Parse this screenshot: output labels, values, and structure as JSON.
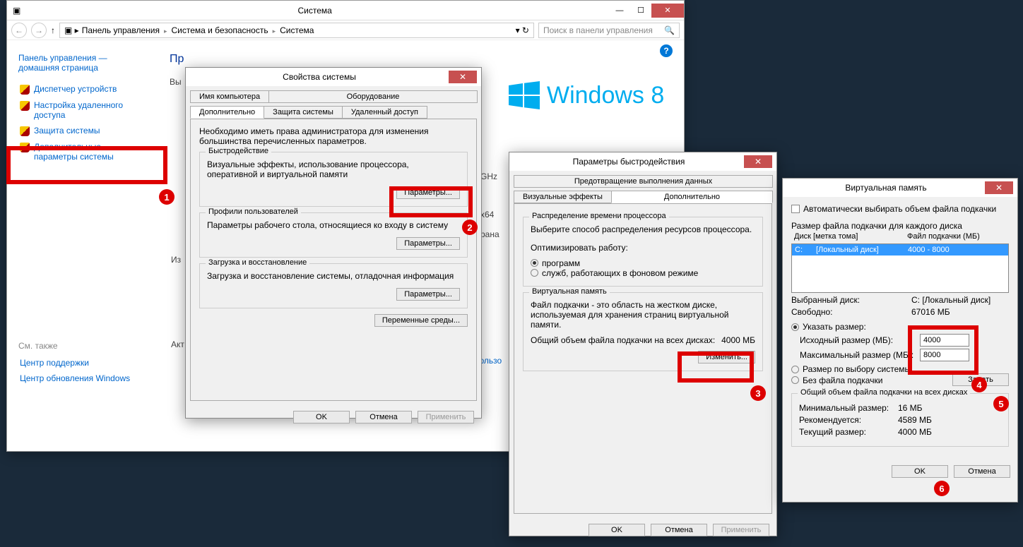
{
  "system_window": {
    "title": "Система",
    "breadcrumb": {
      "root": "Панель управления",
      "b1": "Система и безопасность",
      "b2": "Система"
    },
    "search_placeholder": "Поиск в панели управления",
    "sidebar": {
      "head1": "Панель управления —",
      "head2": "домашняя страница",
      "items": [
        "Диспетчер устройств",
        "Настройка удаленного доступа",
        "Защита системы",
        "Дополнительные параметры системы"
      ],
      "see_also": "См. также",
      "sa1": "Центр поддержки",
      "sa2": "Центр обновления Windows"
    },
    "content": {
      "h": "Пр",
      "l1": "Вы",
      "l2": "Из",
      "l3": "Акт",
      "ghz": "GHz",
      "x64": "x64",
      "rana": "рана",
      "win8": "Windows 8",
      "link": "пользо"
    }
  },
  "props": {
    "title": "Свойства системы",
    "tabs_top": [
      "Имя компьютера",
      "Оборудование"
    ],
    "tabs_bot": [
      "Дополнительно",
      "Защита системы",
      "Удаленный доступ"
    ],
    "admin_note": "Необходимо иметь права администратора для изменения большинства перечисленных параметров.",
    "perf": {
      "t": "Быстродействие",
      "d": "Визуальные эффекты, использование процессора, оперативной и виртуальной памяти",
      "btn": "Параметры..."
    },
    "prof": {
      "t": "Профили пользователей",
      "d": "Параметры рабочего стола, относящиеся ко входу в систему",
      "btn": "Параметры..."
    },
    "boot": {
      "t": "Загрузка и восстановление",
      "d": "Загрузка и восстановление системы, отладочная информация",
      "btn": "Параметры..."
    },
    "env_btn": "Переменные среды...",
    "ok": "OK",
    "cancel": "Отмена",
    "apply": "Применить"
  },
  "perf_dlg": {
    "title": "Параметры быстродействия",
    "tabs_top": [
      "Предотвращение выполнения данных"
    ],
    "tabs_bot": [
      "Визуальные эффекты",
      "Дополнительно"
    ],
    "sched": {
      "t": "Распределение времени процессора",
      "d": "Выберите способ распределения ресурсов процессора.",
      "opt_l": "Оптимизировать работу:",
      "r1": "программ",
      "r2": "служб, работающих в фоновом режиме"
    },
    "vm": {
      "t": "Виртуальная память",
      "d": "Файл подкачки - это область на жестком диске, используемая для хранения страниц виртуальной памяти.",
      "total_l": "Общий объем файла подкачки на всех дисках:",
      "total_v": "4000 МБ",
      "btn": "Изменить..."
    },
    "ok": "OK",
    "cancel": "Отмена",
    "apply": "Применить"
  },
  "vm_dlg": {
    "title": "Виртуальная память",
    "auto": "Автоматически выбирать объем файла подкачки",
    "each": "Размер файла подкачки для каждого диска",
    "col1": "Диск [метка тома]",
    "col2": "Файл подкачки (МБ)",
    "drive": "C:",
    "drive_label": "[Локальный диск]",
    "drive_pf": "4000 - 8000",
    "sel_l": "Выбранный диск:",
    "sel_v": "C:  [Локальный диск]",
    "free_l": "Свободно:",
    "free_v": "67016 МБ",
    "r_custom": "Указать размер:",
    "init_l": "Исходный размер (МБ):",
    "init_v": "4000",
    "max_l": "Максимальный размер (МБ):",
    "max_v": "8000",
    "r_sys": "Размер по выбору системы",
    "r_none": "Без файла подкачки",
    "set_btn": "Задать",
    "all_h": "Общий объем файла подкачки на всех дисках",
    "min_l": "Минимальный размер:",
    "min_v": "16 МБ",
    "rec_l": "Рекомендуется:",
    "rec_v": "4589 МБ",
    "cur_l": "Текущий размер:",
    "cur_v": "4000 МБ",
    "ok": "OK",
    "cancel": "Отмена"
  }
}
